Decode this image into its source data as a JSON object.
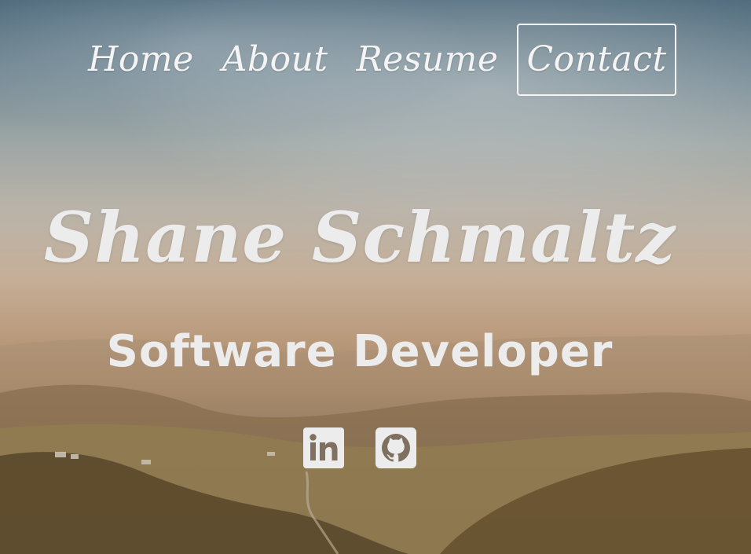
{
  "nav": {
    "items": [
      {
        "label": "Home",
        "active": false
      },
      {
        "label": "About",
        "active": false
      },
      {
        "label": "Resume",
        "active": false
      },
      {
        "label": "Contact",
        "active": true
      }
    ]
  },
  "hero": {
    "name": "Shane Schmaltz",
    "title": "Software Developer"
  },
  "social": {
    "links": [
      {
        "icon": "linkedin-icon"
      },
      {
        "icon": "github-icon"
      }
    ]
  },
  "colors": {
    "text": "#ececec",
    "icon_fill": "#ececec"
  }
}
